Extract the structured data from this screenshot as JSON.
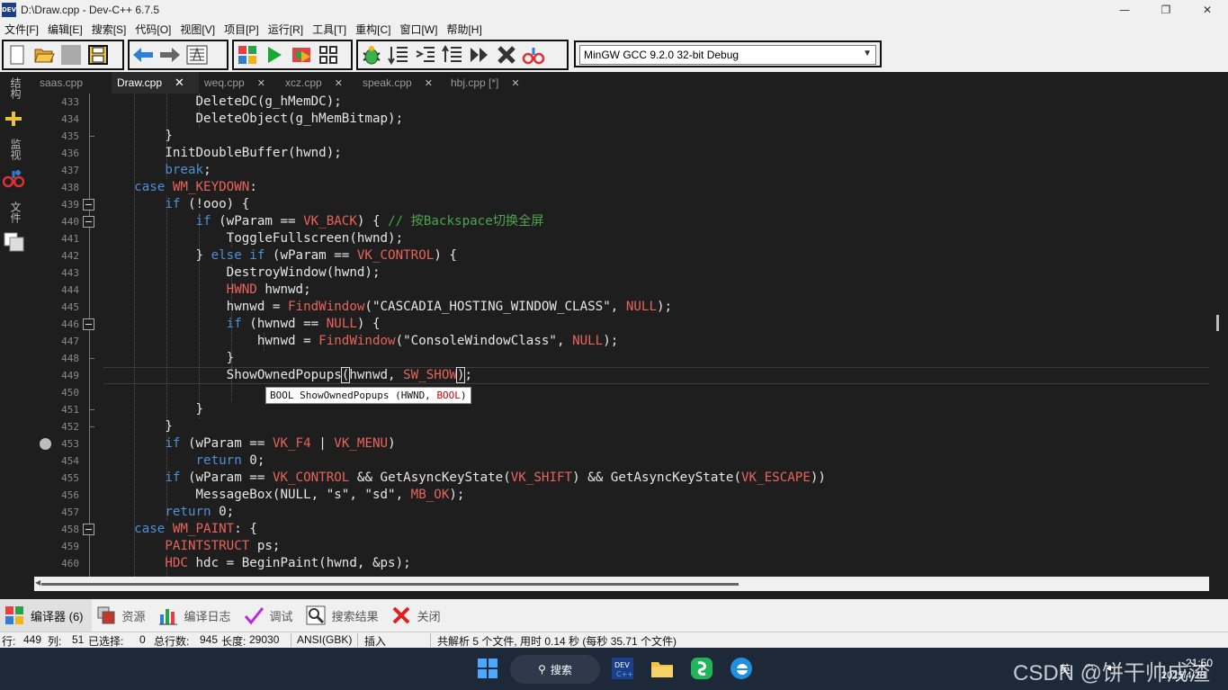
{
  "window": {
    "title": "D:\\Draw.cpp - Dev-C++ 6.7.5",
    "app_icon_text": "DEV",
    "minimize": "—",
    "maximize": "❐",
    "close": "✕"
  },
  "menu": [
    "文件[F]",
    "编辑[E]",
    "搜索[S]",
    "代码[O]",
    "视图[V]",
    "项目[P]",
    "运行[R]",
    "工具[T]",
    "重构[C]",
    "窗口[W]",
    "帮助[H]"
  ],
  "toolbar": {
    "compiler": "MinGW GCC 9.2.0 32-bit Debug"
  },
  "left_panel": {
    "tab1": "结构",
    "tab2": "监视",
    "tab3": "文件"
  },
  "tabs": [
    {
      "label": "saas.cpp",
      "active": false
    },
    {
      "label": "Draw.cpp",
      "active": true
    },
    {
      "label": "weq.cpp",
      "active": false
    },
    {
      "label": "xcz.cpp",
      "active": false
    },
    {
      "label": "speak.cpp",
      "active": false
    },
    {
      "label": "hbj.cpp [*]",
      "active": false
    }
  ],
  "editor": {
    "line_numbers": [
      "433",
      "434",
      "435",
      "436",
      "437",
      "438",
      "439",
      "440",
      "441",
      "442",
      "443",
      "444",
      "445",
      "446",
      "447",
      "448",
      "449",
      "450",
      "451",
      "452",
      "453",
      "454",
      "455",
      "456",
      "457",
      "458",
      "459",
      "460"
    ],
    "calltip": {
      "prefix": "BOOL ShowOwnedPopups (HWND, ",
      "highlight": "BOOL",
      "suffix": ")"
    }
  },
  "bottom_tabs": [
    {
      "label": "编译器 (6)",
      "icon": "compiler-grid-icon"
    },
    {
      "label": "资源",
      "icon": "resources-icon"
    },
    {
      "label": "编译日志",
      "icon": "bar-chart-icon"
    },
    {
      "label": "调试",
      "icon": "check-icon"
    },
    {
      "label": "搜索结果",
      "icon": "search-results-icon"
    },
    {
      "label": "关闭",
      "icon": "close-red-icon"
    }
  ],
  "status": {
    "row_label": "行:",
    "row": "449",
    "col_label": "列:",
    "col": "51",
    "sel_label": "已选择:",
    "sel": "0",
    "total_label": "总行数:",
    "total": "945",
    "length_label": "长度:",
    "length": "29030",
    "encoding": "ANSI(GBK)",
    "mode": "插入",
    "message": "共解析 5 个文件, 用时 0.14 秒 (每秒 35.71 个文件)"
  },
  "taskbar": {
    "search": "搜索",
    "ime": "英",
    "time": "21:50",
    "date": "2025/4/28",
    "watermark": "CSDN @饼干帅成渣"
  }
}
